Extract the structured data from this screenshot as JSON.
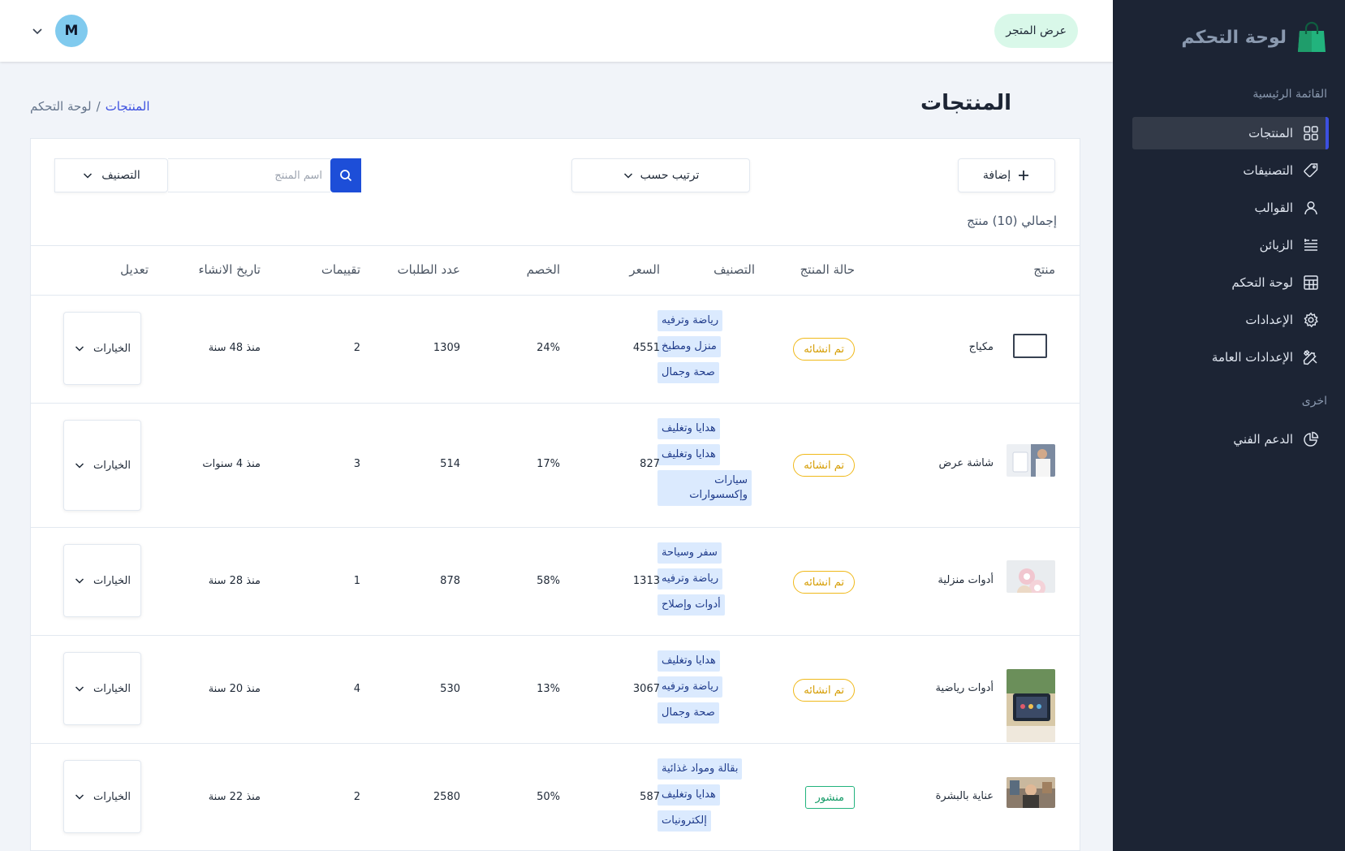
{
  "brand": {
    "title": "لوحة التحكم"
  },
  "sidebar": {
    "main_heading": "القائمة الرئيسية",
    "other_heading": "اخرى",
    "items": [
      {
        "label": "المنتجات",
        "icon": "grid-icon"
      },
      {
        "label": "التصنيفات",
        "icon": "tag-icon"
      },
      {
        "label": "القوالب",
        "icon": "user-icon"
      },
      {
        "label": "الزبائن",
        "icon": "list-icon"
      },
      {
        "label": "لوحة التحكم",
        "icon": "table-icon"
      },
      {
        "label": "الإعدادات",
        "icon": "gear-icon"
      },
      {
        "label": "الإعدادات العامة",
        "icon": "tools-icon"
      }
    ],
    "other_items": [
      {
        "label": "الدعم الفني",
        "icon": "pie-chart-icon"
      }
    ]
  },
  "header": {
    "store_button": "عرض المتجر",
    "avatar_letter": "M"
  },
  "page": {
    "title": "المنتجات",
    "breadcrumb": {
      "root": "لوحة التحكم",
      "separator": "/",
      "current": "المنتجات"
    }
  },
  "toolbar": {
    "add_label": "إضافة",
    "sort_label": "ترتيب حسب",
    "category_label": "التصنيف",
    "search_placeholder": "اسم المنتج",
    "total_label": "إجمالي (10) منتج"
  },
  "table": {
    "headers": [
      "منتج",
      "حالة المنتج",
      "التصنيف",
      "السعر",
      "الخصم",
      "عدد الطلبات",
      "تقييمات",
      "تاريخ الانشاء",
      "تعديل"
    ],
    "options_label": "الخيارات",
    "rows": [
      {
        "name": "مكياج",
        "status": "تم انشائه",
        "categories": [
          "رياضة وترفيه",
          "منزل ومطبخ",
          "صحة وجمال"
        ],
        "price": "4551",
        "discount": "24%",
        "orders": "1309",
        "ratings": "2",
        "created": "منذ 48 سنة"
      },
      {
        "name": "شاشة عرض",
        "status": "تم انشائه",
        "categories": [
          "هدايا وتغليف",
          "هدايا وتغليف",
          "سيارات وإكسسوارات"
        ],
        "price": "827",
        "discount": "17%",
        "orders": "514",
        "ratings": "3",
        "created": "منذ 4 سنوات"
      },
      {
        "name": "أدوات منزلية",
        "status": "تم انشائه",
        "categories": [
          "سفر وسياحة",
          "رياضة وترفيه",
          "أدوات وإصلاح"
        ],
        "price": "1313",
        "discount": "58%",
        "orders": "878",
        "ratings": "1",
        "created": "منذ 28 سنة"
      },
      {
        "name": "أدوات رياضية",
        "status": "تم انشائه",
        "categories": [
          "هدايا وتغليف",
          "رياضة وترفيه",
          "صحة وجمال"
        ],
        "price": "3067",
        "discount": "13%",
        "orders": "530",
        "ratings": "4",
        "created": "منذ 20 سنة"
      },
      {
        "name": "عناية بالبشرة",
        "status": "منشور",
        "categories": [
          "بقالة ومواد غذائية",
          "هدايا وتغليف",
          "إلكترونيات"
        ],
        "price": "587",
        "discount": "50%",
        "orders": "2580",
        "ratings": "2",
        "created": "منذ 22 سنة"
      }
    ]
  },
  "colors": {
    "sidebar_bg": "#1c2434",
    "accent": "#3c50e0",
    "search_button": "#1d4ed8",
    "status_created": "#f0b91a",
    "status_published": "#22b37d",
    "tag_bg": "#dbeafe"
  }
}
